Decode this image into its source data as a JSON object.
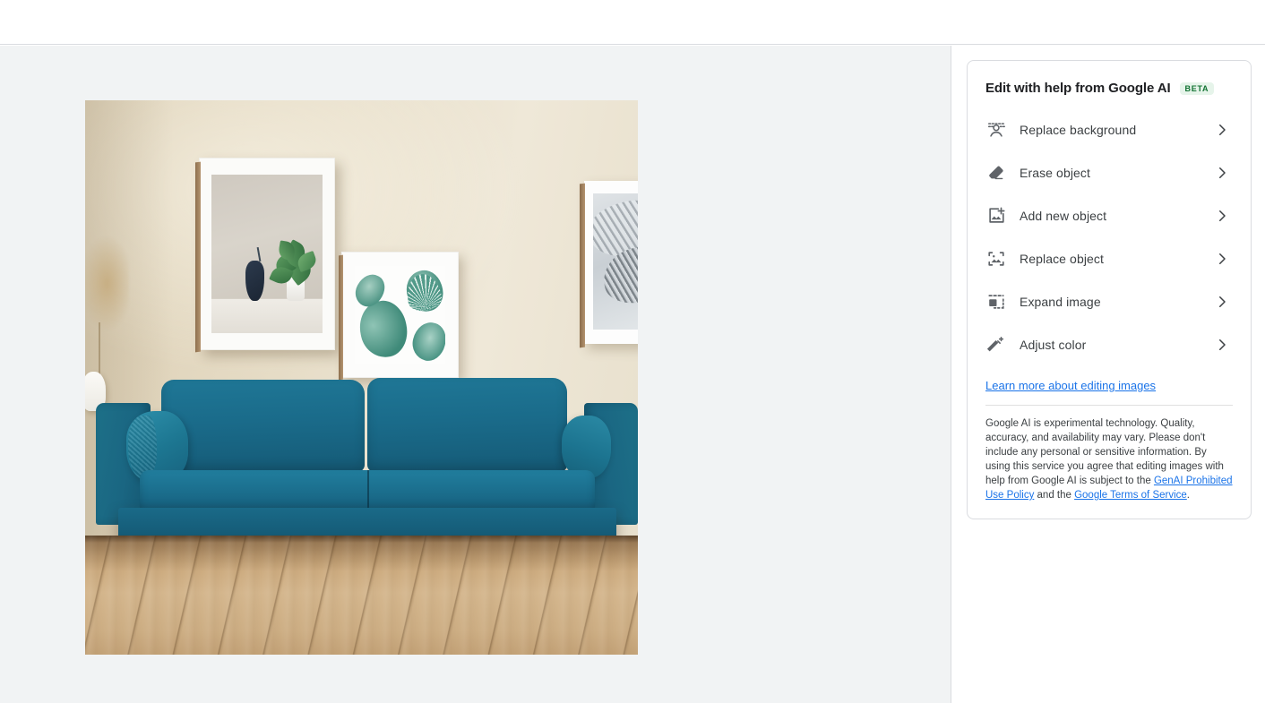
{
  "panel": {
    "title": "Edit with help from Google AI",
    "badge": "BETA",
    "menu_items": [
      {
        "label": "Replace background",
        "icon": "replace-background-icon"
      },
      {
        "label": "Erase object",
        "icon": "eraser-icon"
      },
      {
        "label": "Add new object",
        "icon": "add-image-icon"
      },
      {
        "label": "Replace object",
        "icon": "replace-image-icon"
      },
      {
        "label": "Expand image",
        "icon": "expand-image-icon"
      },
      {
        "label": "Adjust color",
        "icon": "magic-wand-icon"
      }
    ],
    "learn_more": "Learn more about editing images",
    "disclaimer": {
      "part1": "Google AI is experimental technology. Quality, accuracy, and availability may vary. Please don't include any personal or sensitive information. By using this service you agree that editing images with help from Google AI is subject to the ",
      "link1": "GenAI Prohibited Use Policy",
      "part2": " and the ",
      "link2": "Google Terms of Service",
      "part3": "."
    }
  },
  "canvas": {
    "image_alt": "Teal blue sofa in a living room with framed botanical wall art and light oak flooring"
  },
  "colors": {
    "accent_link": "#1a73e8",
    "badge_bg": "#e6f4ea",
    "badge_text": "#137333",
    "canvas_bg": "#f1f3f4",
    "sofa_teal": "#1a6b8a"
  }
}
